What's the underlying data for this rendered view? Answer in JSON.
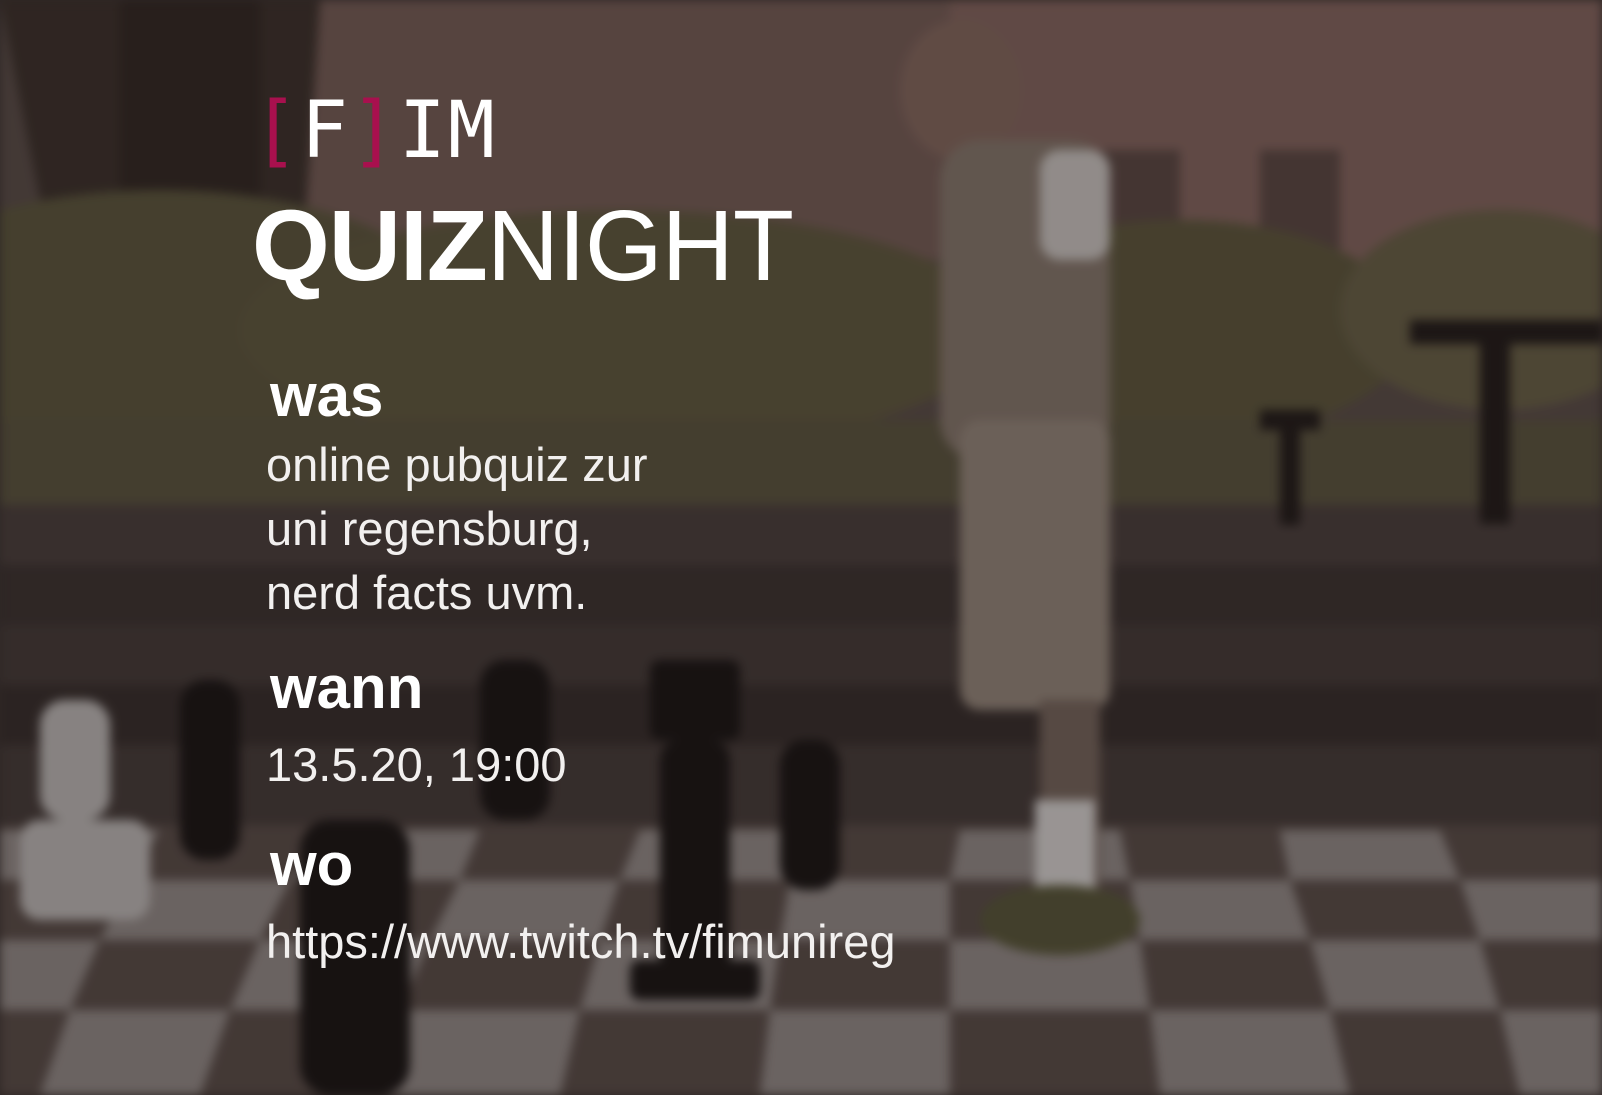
{
  "logo": {
    "open": "[",
    "letter": "F",
    "close": "]",
    "rest": "IM"
  },
  "title": {
    "bold": "QUIZ",
    "light": "NIGHT"
  },
  "was": {
    "label": "was",
    "lines": [
      "online pubquiz zur",
      "uni regensburg,",
      "nerd facts uvm."
    ]
  },
  "wann": {
    "label": "wann",
    "value": "13.5.20, 19:00"
  },
  "wo": {
    "label": "wo",
    "value": "https://www.twitch.tv/fimunireg"
  },
  "colors": {
    "accent": "#a8104e",
    "text": "#ffffff"
  }
}
